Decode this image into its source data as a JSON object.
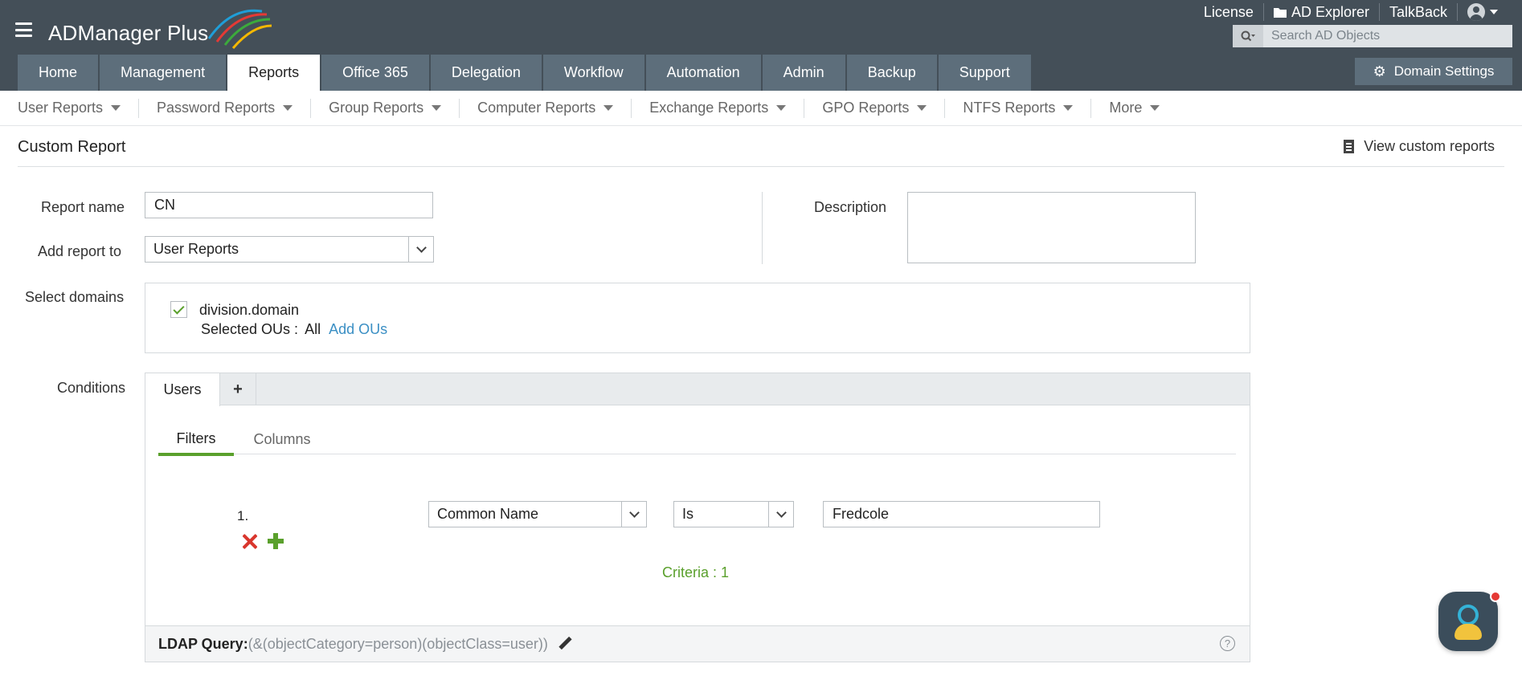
{
  "header": {
    "logo_text": "ADManager Plus",
    "links": [
      "License",
      "AD Explorer",
      "TalkBack"
    ],
    "search_placeholder": "Search AD Objects",
    "domain_settings": "Domain Settings"
  },
  "tabs": [
    {
      "label": "Home"
    },
    {
      "label": "Management"
    },
    {
      "label": "Reports",
      "active": true
    },
    {
      "label": "Office 365"
    },
    {
      "label": "Delegation"
    },
    {
      "label": "Workflow"
    },
    {
      "label": "Automation"
    },
    {
      "label": "Admin"
    },
    {
      "label": "Backup"
    },
    {
      "label": "Support"
    }
  ],
  "submenu": [
    "User Reports",
    "Password Reports",
    "Group Reports",
    "Computer Reports",
    "Exchange Reports",
    "GPO Reports",
    "NTFS Reports",
    "More"
  ],
  "page": {
    "title": "Custom Report",
    "view_custom": "View custom reports"
  },
  "form": {
    "report_name_label": "Report name",
    "report_name_value": "CN",
    "add_to_label": "Add report to",
    "add_to_value": "User Reports",
    "description_label": "Description",
    "description_value": "",
    "domains_label": "Select domains",
    "domain": "division.domain",
    "domain_checked": true,
    "ou_label": "Selected OUs :",
    "ou_value": "All",
    "add_ous": "Add OUs"
  },
  "conditions": {
    "label": "Conditions",
    "tab": "Users",
    "add_tab": "+",
    "inner_tabs": [
      "Filters",
      "Columns"
    ],
    "rows": [
      {
        "num": "1.",
        "attribute": "Common Name",
        "operator": "Is",
        "value": "Fredcole"
      }
    ],
    "criteria": "Criteria : 1",
    "ldap_label": "LDAP Query:",
    "ldap_query": "(&(objectCategory=person)(objectClass=user))"
  },
  "colors": {
    "header_bg": "#444f58",
    "tab_bg": "#5d6e7b",
    "accent_green": "#5aa02c",
    "link_blue": "#3b8fc4",
    "delete_red": "#d9352c"
  },
  "icons": [
    "hamburger-icon",
    "folder-icon",
    "user-icon",
    "search-icon",
    "gear-icon",
    "document-icon",
    "checkmark-icon",
    "plus-icon",
    "delete-icon",
    "pencil-icon",
    "help-icon",
    "chatbot-icon"
  ]
}
